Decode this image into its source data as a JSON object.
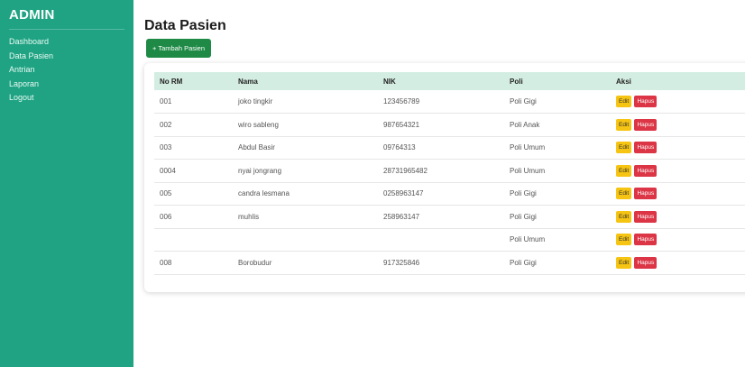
{
  "sidebar": {
    "brand": "ADMIN",
    "items": [
      {
        "label": "Dashboard"
      },
      {
        "label": "Data Pasien"
      },
      {
        "label": "Antrian"
      },
      {
        "label": "Laporan"
      },
      {
        "label": "Logout"
      }
    ]
  },
  "main": {
    "title": "Data Pasien",
    "add_button": "+ Tambah Pasien"
  },
  "table": {
    "headers": {
      "no_rm": "No RM",
      "nama": "Nama",
      "nik": "NIK",
      "poli": "Poli",
      "aksi": "Aksi"
    },
    "edit_label": "Edit",
    "delete_label": "Hapus",
    "rows": [
      {
        "no_rm": "001",
        "nama": "joko tingkir",
        "nik": "123456789",
        "poli": "Poli Gigi"
      },
      {
        "no_rm": "002",
        "nama": "wiro sableng",
        "nik": "987654321",
        "poli": "Poli Anak"
      },
      {
        "no_rm": "003",
        "nama": "Abdul Basir",
        "nik": "09764313",
        "poli": "Poli Umum"
      },
      {
        "no_rm": "0004",
        "nama": "nyai jongrang",
        "nik": "28731965482",
        "poli": "Poli Umum"
      },
      {
        "no_rm": "005",
        "nama": "candra lesmana",
        "nik": "0258963147",
        "poli": "Poli Gigi"
      },
      {
        "no_rm": "006",
        "nama": "muhlis",
        "nik": "258963147",
        "poli": "Poli Gigi"
      },
      {
        "no_rm": "",
        "nama": "",
        "nik": "",
        "poli": "Poli Umum"
      },
      {
        "no_rm": "008",
        "nama": "Borobudur",
        "nik": "917325846",
        "poli": "Poli Gigi"
      }
    ]
  },
  "colors": {
    "sidebar": "#1fa383",
    "add_button": "#1e8a46",
    "table_header": "#d4ede2",
    "edit": "#f6c412",
    "delete": "#dc3545"
  }
}
